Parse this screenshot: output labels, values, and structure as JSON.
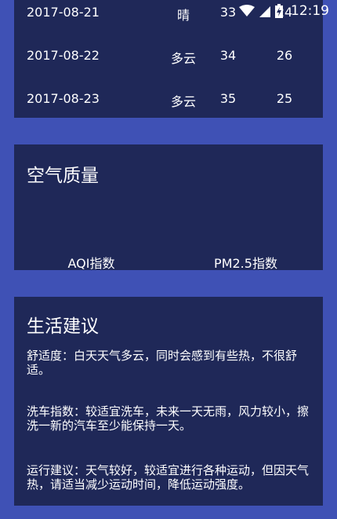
{
  "status_bar": {
    "time": "12:19",
    "wifi_icon": "wifi-icon",
    "signal_icon": "signal-icon",
    "battery_icon": "battery-charging-icon"
  },
  "forecast": {
    "rows": [
      {
        "date": "2017-08-21",
        "condition": "晴",
        "max": "33",
        "min": "24"
      },
      {
        "date": "2017-08-22",
        "condition": "多云",
        "max": "34",
        "min": "26"
      },
      {
        "date": "2017-08-23",
        "condition": "多云",
        "max": "35",
        "min": "25"
      }
    ]
  },
  "aqi": {
    "title": "空气质量",
    "aqi_value": "",
    "aqi_label": "AQI指数",
    "pm25_value": "",
    "pm25_label": "PM2.5指数"
  },
  "suggestion": {
    "title": "生活建议",
    "comfort": "舒适度：白天天气多云，同时会感到有些热，不很舒适。",
    "car_wash": "洗车指数：较适宜洗车，未来一天无雨，风力较小，擦洗一新的汽车至少能保持一天。",
    "sport": "运行建议：天气较好，较适宜进行各种运动，但因天气热，请适当减少运动时间，降低运动强度。"
  },
  "colors": {
    "background": "#3f51b5",
    "card": "#1f2858",
    "text": "#ffffff"
  }
}
